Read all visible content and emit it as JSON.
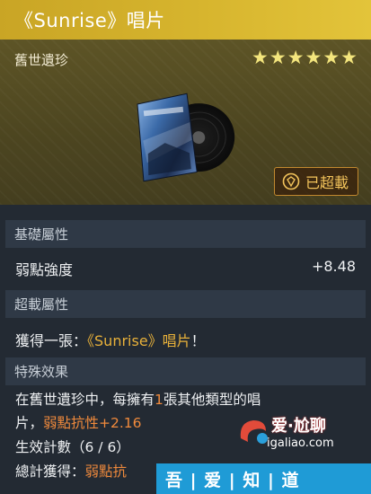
{
  "item": {
    "name": "《Sunrise》唱片",
    "rarity_label": "舊世遺珍",
    "stars": [
      "★",
      "★",
      "★",
      "★",
      "★",
      "★"
    ],
    "overloaded_badge": "已超載",
    "colors": {
      "title_bar": "#d4b32c",
      "highlight_gold": "#e8b13a",
      "highlight_orange": "#f08a3c",
      "star": "#f3e57d"
    }
  },
  "sections": {
    "base": {
      "header": "基礎屬性",
      "stat_label": "弱點強度",
      "stat_value": "+8.48"
    },
    "overload": {
      "header": "超載屬性",
      "line_prefix": "獲得一張：",
      "line_item": "《Sunrise》唱片",
      "line_suffix": "！"
    },
    "special": {
      "header": "特殊效果",
      "line1_prefix": "在舊世遺珍中，每擁有",
      "line1_count": "1",
      "line1_suffix": "張其他類型的唱",
      "line2_prefix": "片，",
      "line2_effect": "弱點抗性+2.16",
      "line3": "生效計數（6 / 6）",
      "line4_prefix": "總計獲得：",
      "line4_effect": "弱點抗"
    }
  },
  "watermark": {
    "brand": "爱·尬聊",
    "url": "igaliao.com",
    "slogan": "吾 | 爱 | 知 | 道"
  }
}
